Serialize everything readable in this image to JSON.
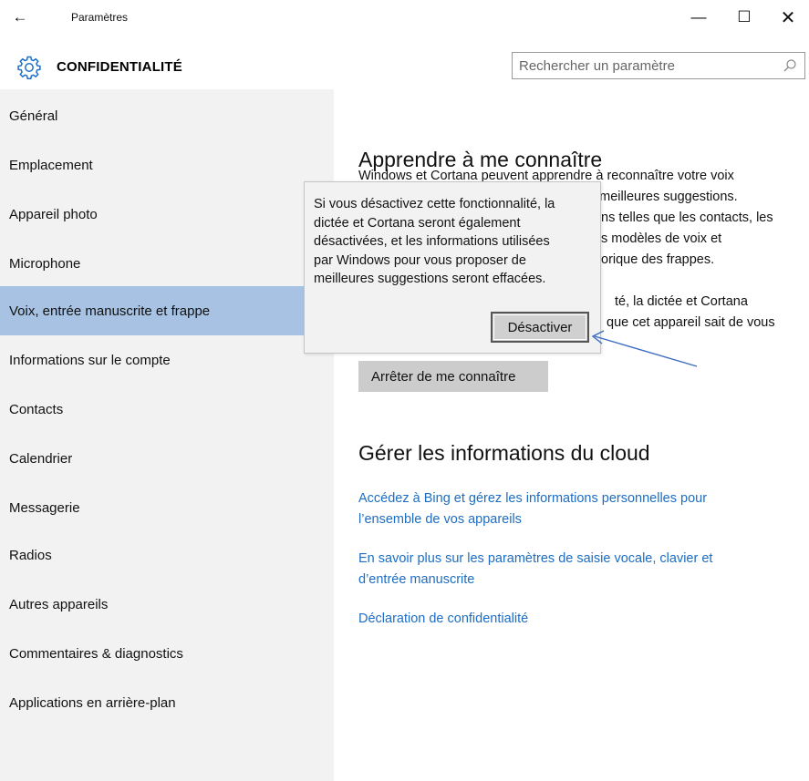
{
  "window": {
    "back_glyph": "←",
    "title": "Paramètres",
    "minimize_glyph": "—",
    "maximize_glyph": "☐",
    "close_glyph": "✕"
  },
  "header": {
    "icon": "gear-icon",
    "title": "CONFIDENTIALITÉ",
    "search_placeholder": "Rechercher un paramètre",
    "search_icon": "search-icon"
  },
  "sidebar": {
    "selected_index": 4,
    "selected_color": "#a7c2e3",
    "items": [
      {
        "label": "Général"
      },
      {
        "label": "Emplacement"
      },
      {
        "label": "Appareil photo"
      },
      {
        "label": "Microphone"
      },
      {
        "label": "Voix, entrée manuscrite et frappe"
      },
      {
        "label": "Informations sur le compte"
      },
      {
        "label": "Contacts"
      },
      {
        "label": "Calendrier"
      },
      {
        "label": "Messagerie"
      },
      {
        "label": "Radios"
      },
      {
        "label": "Autres appareils"
      },
      {
        "label": "Commentaires & diagnostics"
      },
      {
        "label": "Applications en arrière-plan"
      }
    ]
  },
  "main": {
    "section1_title": "Apprendre à me connaître",
    "para1": [
      "Windows et Cortana peuvent apprendre à reconnaître votre voix",
      "de meilleures suggestions.",
      "ns telles que les contacts, les",
      "s modèles de voix et",
      "orique des frappes."
    ],
    "para2": [
      "té, la dictée et Cortana",
      "que cet appareil sait de vous"
    ],
    "stop_button": "Arrêter de me connaître",
    "section2_title": "Gérer les informations du cloud",
    "links": [
      {
        "lines": [
          "Accédez à Bing et gérez les informations personnelles pour",
          "l’ensemble de vos appareils"
        ]
      },
      {
        "lines": [
          "En savoir plus sur les paramètres de saisie vocale, clavier et",
          "d’entrée manuscrite"
        ]
      },
      {
        "lines": [
          "Déclaration de confidentialité"
        ]
      }
    ],
    "link_color": "#1d6dc4"
  },
  "popup": {
    "lines": [
      "Si vous désactivez cette fonctionnalité, la",
      "dictée et Cortana seront également",
      "désactivées, et les informations utilisées",
      "par Windows pour vous proposer de",
      "meilleures suggestions seront effacées."
    ],
    "button": "Désactiver"
  },
  "annotation": {
    "arrow_color": "#3b6bc0"
  }
}
